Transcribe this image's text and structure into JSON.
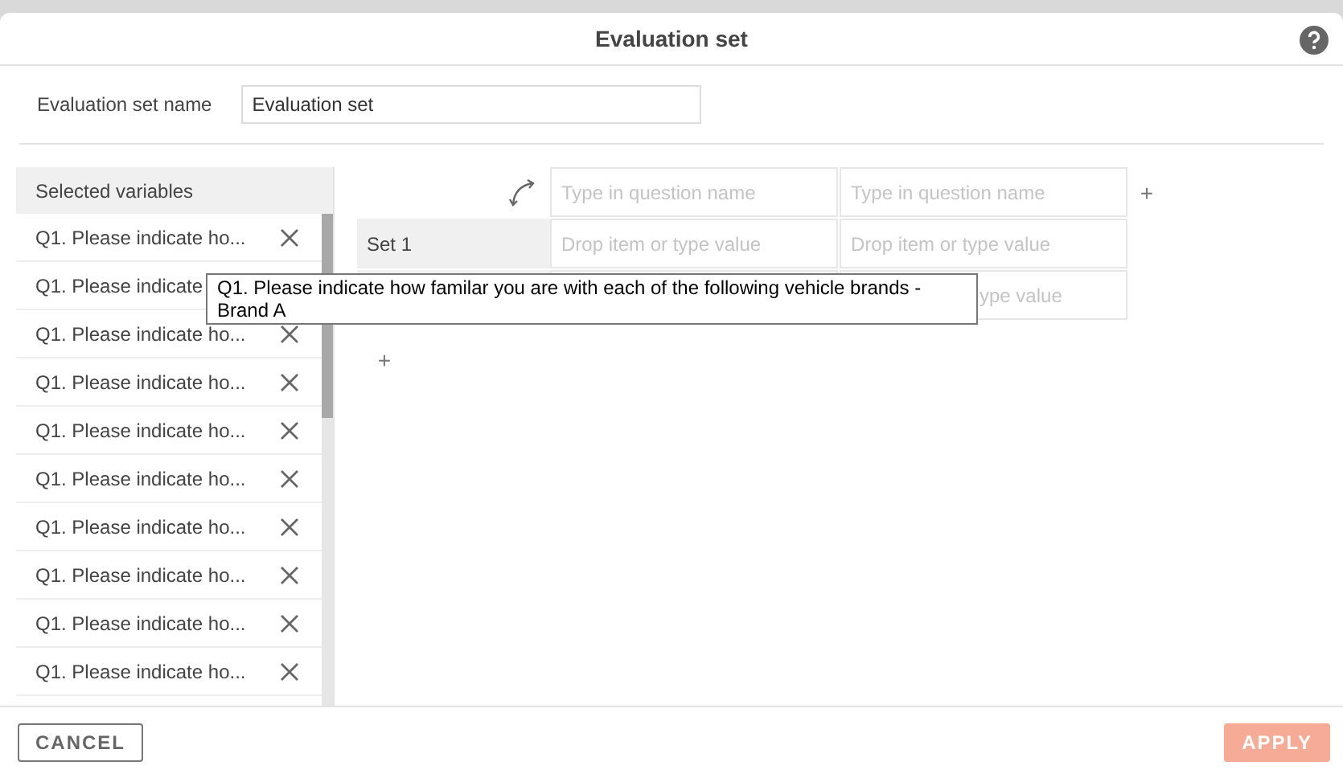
{
  "dialog": {
    "title": "Evaluation set"
  },
  "name_field": {
    "label": "Evaluation set name",
    "value": "Evaluation set"
  },
  "selected_variables": {
    "header": "Selected variables",
    "items": [
      {
        "label": "Q1. Please indicate ho...",
        "kind": "removable"
      },
      {
        "label": "Q1. Please indicate",
        "kind": "covered"
      },
      {
        "label": "Q1. Please indicate ho...",
        "kind": "removable"
      },
      {
        "label": "Q1. Please indicate ho...",
        "kind": "removable"
      },
      {
        "label": "Q1. Please indicate ho...",
        "kind": "removable"
      },
      {
        "label": "Q1. Please indicate ho...",
        "kind": "removable"
      },
      {
        "label": "Q1. Please indicate ho...",
        "kind": "removable"
      },
      {
        "label": "Q1. Please indicate ho...",
        "kind": "removable"
      },
      {
        "label": "Q1. Please indicate ho...",
        "kind": "removable"
      },
      {
        "label": "Q1. Please indicate ho...",
        "kind": "removable"
      }
    ]
  },
  "grid": {
    "columns": [
      {
        "placeholder": "Type in question name"
      },
      {
        "placeholder": "Type in question name"
      }
    ],
    "rows": [
      {
        "label": "Set 1",
        "cells": [
          {
            "placeholder": "Drop item or type value"
          },
          {
            "placeholder": "Drop item or type value"
          }
        ]
      },
      {
        "cells": [
          {},
          {
            "placeholder": "ype value"
          }
        ]
      }
    ],
    "add_column": "+",
    "add_row": "+"
  },
  "tooltip": {
    "text": "Q1. Please indicate how familar you are with each of the following vehicle brands - Brand A"
  },
  "buttons": {
    "cancel": "CANCEL",
    "apply": {
      "label": "APPLY",
      "disabled": true
    }
  }
}
